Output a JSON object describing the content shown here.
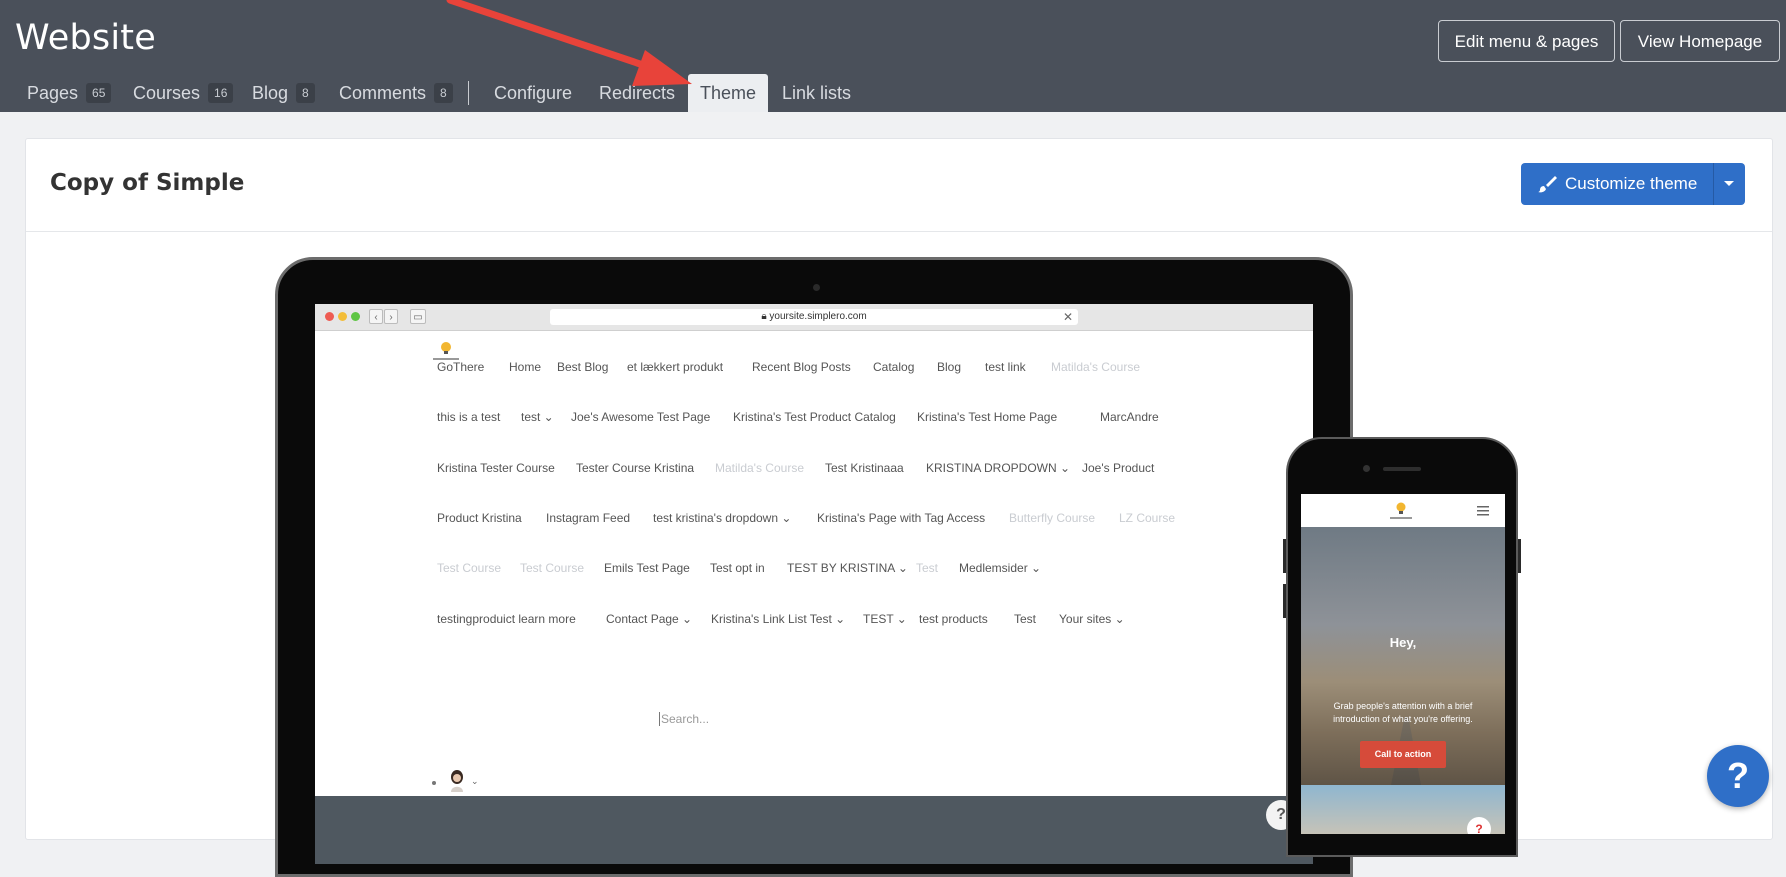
{
  "header": {
    "title": "Website",
    "edit_button": "Edit menu & pages",
    "view_button": "View Homepage"
  },
  "tabs": [
    {
      "label": "Pages",
      "count": "65"
    },
    {
      "label": "Courses",
      "count": "16"
    },
    {
      "label": "Blog",
      "count": "8"
    },
    {
      "label": "Comments",
      "count": "8"
    },
    {
      "label": "Configure"
    },
    {
      "label": "Redirects"
    },
    {
      "label": "Theme",
      "active": true
    },
    {
      "label": "Link lists"
    }
  ],
  "theme": {
    "name": "Copy of Simple",
    "customize_button": "Customize theme"
  },
  "preview": {
    "url": "yoursite.simplero.com",
    "nav_rows": [
      [
        "GoThere",
        "Home",
        "Best Blog",
        "et lækkert produkt",
        "Recent Blog Posts",
        "Catalog",
        "Blog",
        "test link",
        "Matilda's Course"
      ],
      [
        "this is a test",
        "test ⌄",
        "Joe's Awesome Test Page",
        "Kristina's Test Product Catalog",
        "Kristina's Test Home Page",
        "MarcAndre"
      ],
      [
        "Kristina Tester Course",
        "Tester Course Kristina",
        "Matilda's Course",
        "Test Kristinaaa",
        "KRISTINA DROPDOWN ⌄",
        "Joe's Product"
      ],
      [
        "Product Kristina",
        "Instagram Feed",
        "test kristina's dropdown ⌄",
        "Kristina's Page with Tag Access",
        "Butterfly Course",
        "LZ Course"
      ],
      [
        "Test Course",
        "Test Course",
        "Emils Test Page",
        "Test opt in",
        "TEST BY KRISTINA ⌄",
        "Test",
        "Medlemsider ⌄"
      ],
      [
        "testingproduict learn more",
        "Contact Page ⌄",
        "Kristina's Link List Test ⌄",
        "TEST ⌄",
        "test products",
        "Test",
        "Your sites ⌄"
      ]
    ],
    "search_placeholder": "Search...",
    "mobile": {
      "hero_title": "Hey,",
      "hero_text": "Grab people's attention with a brief introduction of what you're offering.",
      "cta": "Call to action"
    }
  },
  "help_label": "?",
  "colors": {
    "topbar": "#4a505a",
    "accent": "#2f6fc8",
    "cta": "#d64b3a",
    "annotation_arrow": "#e8433a"
  }
}
